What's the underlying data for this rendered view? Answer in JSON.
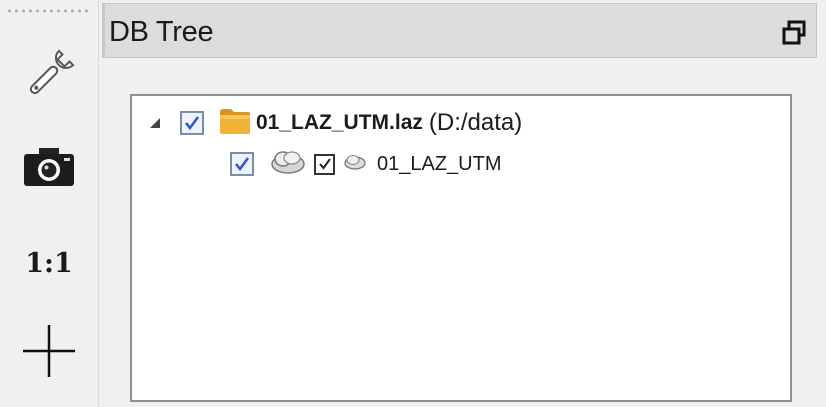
{
  "toolbar": {
    "items": [
      {
        "icon": "wrench-icon"
      },
      {
        "icon": "camera-icon"
      },
      {
        "label": "1:1"
      },
      {
        "icon": "crosshair-icon"
      }
    ]
  },
  "panel": {
    "title": "DB Tree",
    "restore_icon": "restore-icon"
  },
  "tree": {
    "nodes": [
      {
        "checked": true,
        "expanded": true,
        "icon": "folder-icon",
        "name": "01_LAZ_UTM.laz",
        "path": "(D:/data)",
        "children": [
          {
            "checked": true,
            "icon": "point-cloud-icon",
            "sub_checked": true,
            "sub_icon": "cloud-icon",
            "name": "01_LAZ_UTM"
          }
        ]
      }
    ]
  },
  "colors": {
    "checkbox_border": "#7a8ea8",
    "checkmark": "#2a57c9",
    "folder": "#e9a92a",
    "title_bar": "#dcdcdc"
  }
}
